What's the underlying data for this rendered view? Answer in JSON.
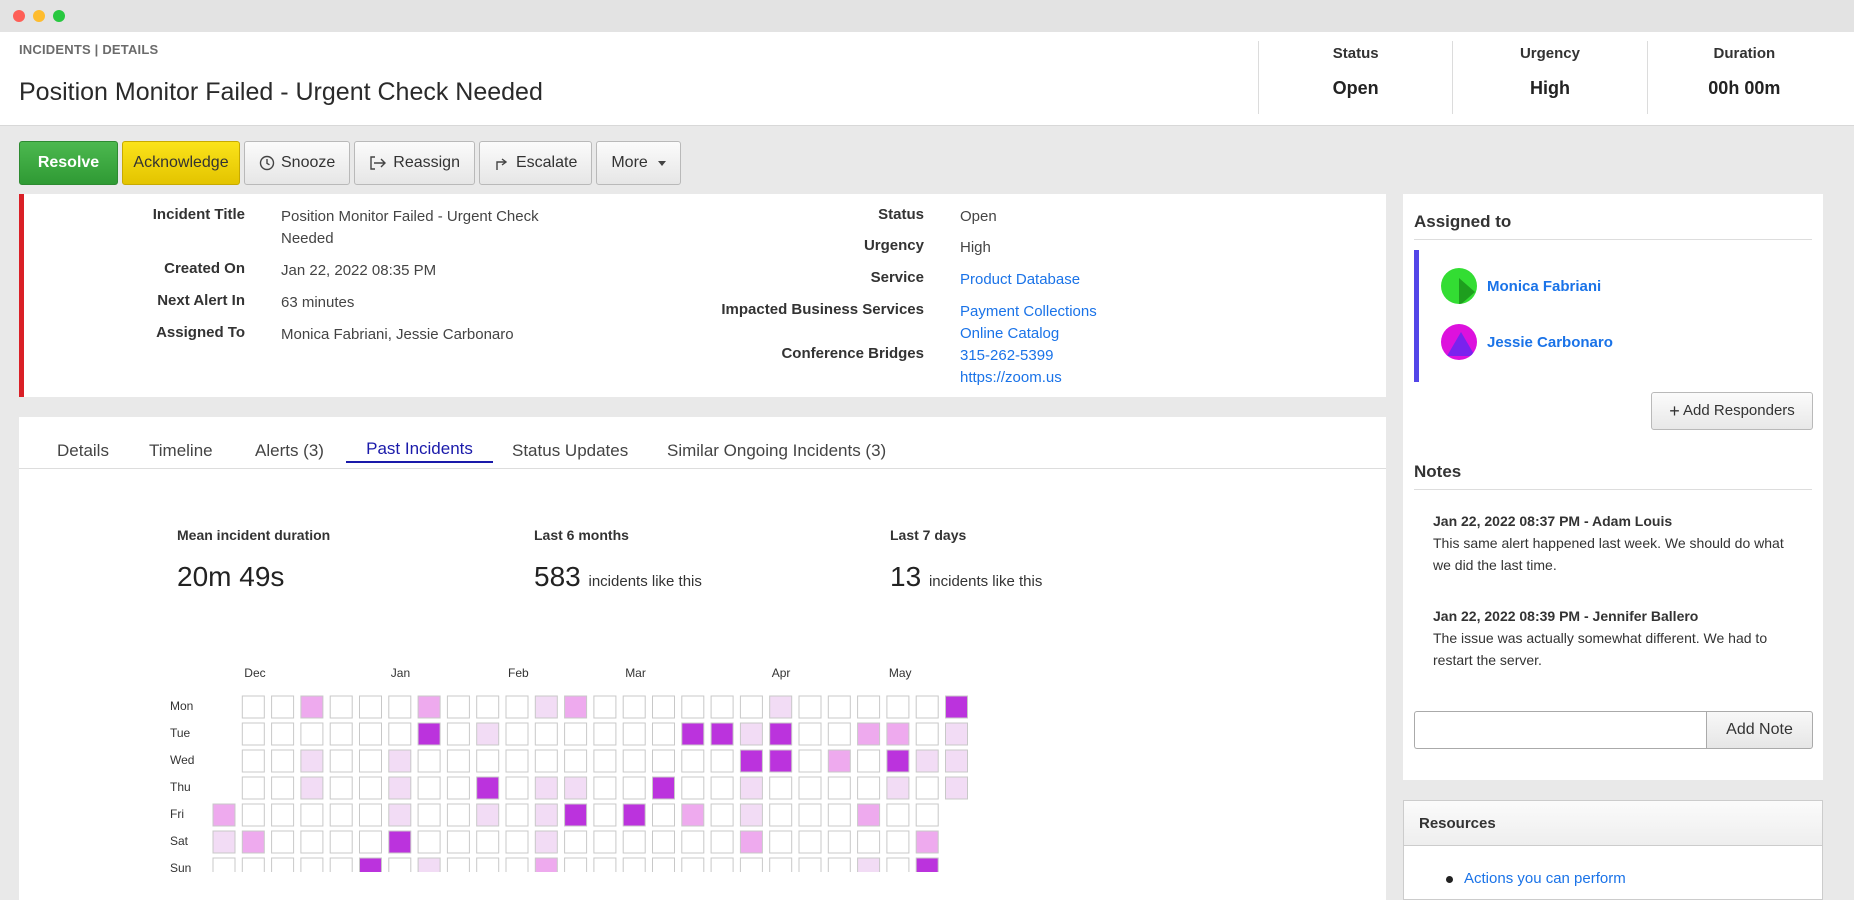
{
  "window": {
    "controls": [
      "close",
      "minimize",
      "maximize"
    ]
  },
  "header": {
    "breadcrumb": "INCIDENTS | DETAILS",
    "title": "Position Monitor Failed - Urgent Check Needed",
    "stats": [
      {
        "label": "Status",
        "value": "Open"
      },
      {
        "label": "Urgency",
        "value": "High"
      },
      {
        "label": "Duration",
        "value": "00h 00m"
      }
    ]
  },
  "toolbar": {
    "resolve": "Resolve",
    "acknowledge": "Acknowledge",
    "snooze": "Snooze",
    "reassign": "Reassign",
    "escalate": "Escalate",
    "more": "More"
  },
  "details": {
    "left": [
      {
        "label": "Incident Title",
        "value": "Position Monitor Failed - Urgent Check Needed"
      },
      {
        "label": "Created On",
        "value": "Jan 22, 2022 08:35 PM"
      },
      {
        "label": "Next Alert In",
        "value": "63 minutes"
      },
      {
        "label": "Assigned To",
        "value": "Monica Fabriani, Jessie Carbonaro"
      }
    ],
    "right": {
      "status_label": "Status",
      "status": "Open",
      "urgency_label": "Urgency",
      "urgency": "High",
      "service_label": "Service",
      "service": "Product Database",
      "impacted_label": "Impacted Business Services",
      "impacted": [
        "Payment Collections",
        "Online Catalog"
      ],
      "bridges_label": "Conference Bridges",
      "bridges": [
        "315-262-5399",
        "https://zoom.us"
      ]
    }
  },
  "tabs": [
    {
      "label": "Details",
      "active": false
    },
    {
      "label": "Timeline",
      "active": false
    },
    {
      "label": "Alerts (3)",
      "active": false
    },
    {
      "label": "Past Incidents",
      "active": true
    },
    {
      "label": "Status Updates",
      "active": false
    },
    {
      "label": "Similar Ongoing Incidents (3)",
      "active": false
    }
  ],
  "past": {
    "mean_label": "Mean incident duration",
    "mean_value": "20m 49s",
    "six_label": "Last 6 months",
    "six_value": "583",
    "six_suffix": "incidents like this",
    "seven_label": "Last 7 days",
    "seven_value": "13",
    "seven_suffix": "incidents like this"
  },
  "chart_data": {
    "type": "heatmap",
    "title": "",
    "months": [
      "Dec",
      "Jan",
      "Feb",
      "Mar",
      "Apr",
      "May"
    ],
    "month_week_index": [
      1,
      6,
      10,
      14,
      19,
      23
    ],
    "days": [
      "Mon",
      "Tue",
      "Wed",
      "Thu",
      "Fri",
      "Sat",
      "Sun"
    ],
    "weeks": 26,
    "levels_legend": "0 = none, 1 = light, 2 = medium, 3 = dark",
    "colors": [
      "#ffffff",
      "#f2dcf5",
      "#eeaaee",
      "#bb33dd"
    ],
    "grid": [
      [
        null,
        0,
        0,
        2,
        0,
        0,
        0,
        2,
        0,
        0,
        0,
        1,
        2,
        0,
        0,
        0,
        0,
        0,
        0,
        1,
        0,
        0,
        0,
        0,
        0,
        3
      ],
      [
        null,
        0,
        0,
        0,
        0,
        0,
        0,
        3,
        0,
        1,
        0,
        0,
        0,
        0,
        0,
        0,
        3,
        3,
        1,
        3,
        0,
        0,
        2,
        2,
        0,
        1
      ],
      [
        null,
        0,
        0,
        1,
        0,
        0,
        1,
        0,
        0,
        0,
        0,
        0,
        0,
        0,
        0,
        0,
        0,
        0,
        3,
        3,
        0,
        2,
        0,
        3,
        1,
        1
      ],
      [
        null,
        0,
        0,
        1,
        0,
        0,
        1,
        0,
        0,
        3,
        0,
        1,
        1,
        0,
        0,
        3,
        0,
        0,
        1,
        0,
        0,
        0,
        0,
        1,
        0,
        1
      ],
      [
        2,
        0,
        0,
        0,
        0,
        0,
        1,
        0,
        0,
        1,
        0,
        1,
        3,
        0,
        3,
        0,
        2,
        0,
        1,
        0,
        0,
        0,
        2,
        0,
        0,
        null
      ],
      [
        1,
        2,
        0,
        0,
        0,
        0,
        3,
        0,
        0,
        0,
        0,
        1,
        0,
        0,
        0,
        0,
        0,
        0,
        2,
        0,
        0,
        0,
        0,
        0,
        2,
        null
      ],
      [
        0,
        0,
        0,
        0,
        0,
        3,
        0,
        1,
        0,
        0,
        0,
        2,
        0,
        0,
        0,
        0,
        0,
        0,
        0,
        0,
        0,
        0,
        1,
        0,
        3,
        null
      ]
    ]
  },
  "assigned": {
    "title": "Assigned to",
    "people": [
      {
        "name": "Monica Fabriani",
        "color": "#33dd33"
      },
      {
        "name": "Jessie Carbonaro",
        "color": "#dd11dd"
      }
    ],
    "add_label": "Add Responders"
  },
  "notes": {
    "title": "Notes",
    "items": [
      {
        "head": "Jan 22, 2022 08:37 PM - Adam Louis",
        "body": "This same alert happened last week. We should do what we did the last time."
      },
      {
        "head": "Jan 22, 2022 08:39 PM - Jennifer Ballero",
        "body": "The issue was actually somewhat different. We had to restart the server."
      }
    ],
    "input_placeholder": "",
    "add_label": "Add Note"
  },
  "resources": {
    "title": "Resources",
    "items": [
      "Actions you can perform"
    ]
  }
}
